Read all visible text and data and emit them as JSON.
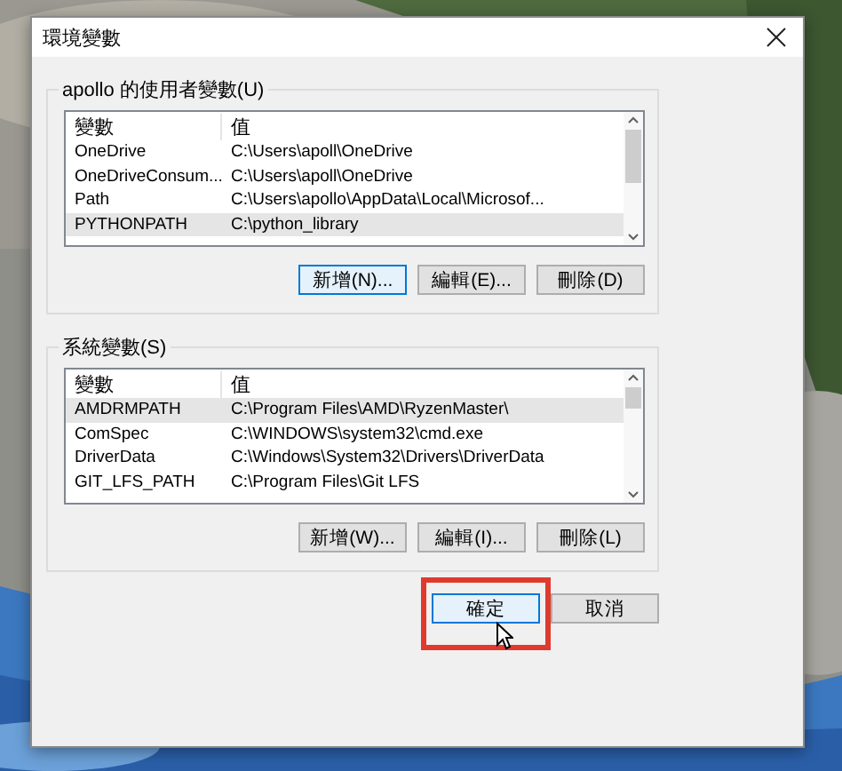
{
  "window": {
    "title": "環境變數"
  },
  "user_variables": {
    "label": "apollo 的使用者變數(U)",
    "columns": [
      "變數",
      "值"
    ],
    "rows": [
      {
        "variable": "OneDrive",
        "value": "C:\\Users\\apoll\\OneDrive",
        "selected": false
      },
      {
        "variable": "OneDriveConsum...",
        "value": "C:\\Users\\apoll\\OneDrive",
        "selected": false
      },
      {
        "variable": "Path",
        "value": "C:\\Users\\apollo\\AppData\\Local\\Microsof...",
        "selected": false
      },
      {
        "variable": "PYTHONPATH",
        "value": "C:\\python_library",
        "selected": true
      }
    ],
    "buttons": [
      {
        "label": "新增(N)...",
        "focused": true
      },
      {
        "label": "編輯(E)...",
        "focused": false
      },
      {
        "label": "刪除(D)",
        "focused": false
      }
    ]
  },
  "system_variables": {
    "label": "系統變數(S)",
    "columns": [
      "變數",
      "值"
    ],
    "rows": [
      {
        "variable": "AMDRMPATH",
        "value": "C:\\Program Files\\AMD\\RyzenMaster\\",
        "selected": true
      },
      {
        "variable": "ComSpec",
        "value": "C:\\WINDOWS\\system32\\cmd.exe",
        "selected": false
      },
      {
        "variable": "DriverData",
        "value": "C:\\Windows\\System32\\Drivers\\DriverData",
        "selected": false
      },
      {
        "variable": "GIT_LFS_PATH",
        "value": "C:\\Program Files\\Git LFS",
        "selected": false
      }
    ],
    "buttons": [
      {
        "label": "新增(W)...",
        "focused": false
      },
      {
        "label": "編輯(I)...",
        "focused": false
      },
      {
        "label": "刪除(L)",
        "focused": false
      }
    ]
  },
  "footer_buttons": [
    {
      "label": "確定",
      "focused": true
    },
    {
      "label": "取消",
      "focused": false
    }
  ]
}
